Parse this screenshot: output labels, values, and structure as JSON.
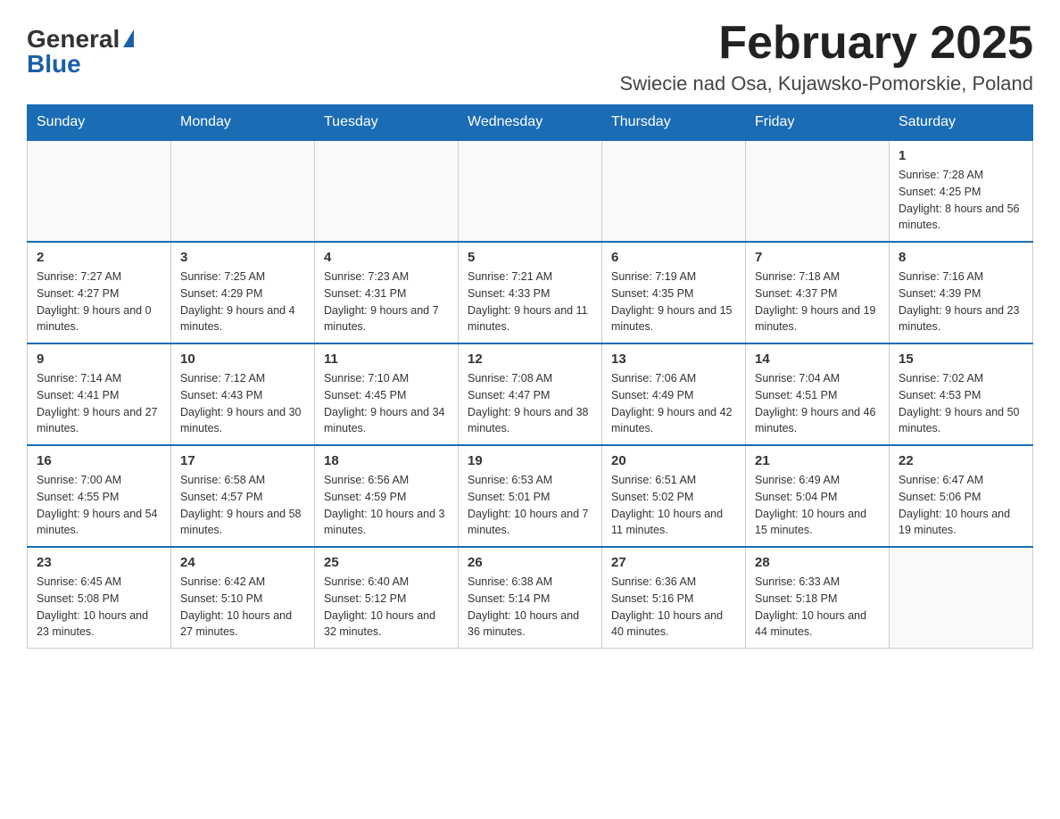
{
  "header": {
    "logo_general": "General",
    "logo_blue": "Blue",
    "title": "February 2025",
    "subtitle": "Swiecie nad Osa, Kujawsko-Pomorskie, Poland"
  },
  "days_of_week": [
    "Sunday",
    "Monday",
    "Tuesday",
    "Wednesday",
    "Thursday",
    "Friday",
    "Saturday"
  ],
  "weeks": [
    [
      {
        "day": "",
        "info": ""
      },
      {
        "day": "",
        "info": ""
      },
      {
        "day": "",
        "info": ""
      },
      {
        "day": "",
        "info": ""
      },
      {
        "day": "",
        "info": ""
      },
      {
        "day": "",
        "info": ""
      },
      {
        "day": "1",
        "info": "Sunrise: 7:28 AM\nSunset: 4:25 PM\nDaylight: 8 hours and 56 minutes."
      }
    ],
    [
      {
        "day": "2",
        "info": "Sunrise: 7:27 AM\nSunset: 4:27 PM\nDaylight: 9 hours and 0 minutes."
      },
      {
        "day": "3",
        "info": "Sunrise: 7:25 AM\nSunset: 4:29 PM\nDaylight: 9 hours and 4 minutes."
      },
      {
        "day": "4",
        "info": "Sunrise: 7:23 AM\nSunset: 4:31 PM\nDaylight: 9 hours and 7 minutes."
      },
      {
        "day": "5",
        "info": "Sunrise: 7:21 AM\nSunset: 4:33 PM\nDaylight: 9 hours and 11 minutes."
      },
      {
        "day": "6",
        "info": "Sunrise: 7:19 AM\nSunset: 4:35 PM\nDaylight: 9 hours and 15 minutes."
      },
      {
        "day": "7",
        "info": "Sunrise: 7:18 AM\nSunset: 4:37 PM\nDaylight: 9 hours and 19 minutes."
      },
      {
        "day": "8",
        "info": "Sunrise: 7:16 AM\nSunset: 4:39 PM\nDaylight: 9 hours and 23 minutes."
      }
    ],
    [
      {
        "day": "9",
        "info": "Sunrise: 7:14 AM\nSunset: 4:41 PM\nDaylight: 9 hours and 27 minutes."
      },
      {
        "day": "10",
        "info": "Sunrise: 7:12 AM\nSunset: 4:43 PM\nDaylight: 9 hours and 30 minutes."
      },
      {
        "day": "11",
        "info": "Sunrise: 7:10 AM\nSunset: 4:45 PM\nDaylight: 9 hours and 34 minutes."
      },
      {
        "day": "12",
        "info": "Sunrise: 7:08 AM\nSunset: 4:47 PM\nDaylight: 9 hours and 38 minutes."
      },
      {
        "day": "13",
        "info": "Sunrise: 7:06 AM\nSunset: 4:49 PM\nDaylight: 9 hours and 42 minutes."
      },
      {
        "day": "14",
        "info": "Sunrise: 7:04 AM\nSunset: 4:51 PM\nDaylight: 9 hours and 46 minutes."
      },
      {
        "day": "15",
        "info": "Sunrise: 7:02 AM\nSunset: 4:53 PM\nDaylight: 9 hours and 50 minutes."
      }
    ],
    [
      {
        "day": "16",
        "info": "Sunrise: 7:00 AM\nSunset: 4:55 PM\nDaylight: 9 hours and 54 minutes."
      },
      {
        "day": "17",
        "info": "Sunrise: 6:58 AM\nSunset: 4:57 PM\nDaylight: 9 hours and 58 minutes."
      },
      {
        "day": "18",
        "info": "Sunrise: 6:56 AM\nSunset: 4:59 PM\nDaylight: 10 hours and 3 minutes."
      },
      {
        "day": "19",
        "info": "Sunrise: 6:53 AM\nSunset: 5:01 PM\nDaylight: 10 hours and 7 minutes."
      },
      {
        "day": "20",
        "info": "Sunrise: 6:51 AM\nSunset: 5:02 PM\nDaylight: 10 hours and 11 minutes."
      },
      {
        "day": "21",
        "info": "Sunrise: 6:49 AM\nSunset: 5:04 PM\nDaylight: 10 hours and 15 minutes."
      },
      {
        "day": "22",
        "info": "Sunrise: 6:47 AM\nSunset: 5:06 PM\nDaylight: 10 hours and 19 minutes."
      }
    ],
    [
      {
        "day": "23",
        "info": "Sunrise: 6:45 AM\nSunset: 5:08 PM\nDaylight: 10 hours and 23 minutes."
      },
      {
        "day": "24",
        "info": "Sunrise: 6:42 AM\nSunset: 5:10 PM\nDaylight: 10 hours and 27 minutes."
      },
      {
        "day": "25",
        "info": "Sunrise: 6:40 AM\nSunset: 5:12 PM\nDaylight: 10 hours and 32 minutes."
      },
      {
        "day": "26",
        "info": "Sunrise: 6:38 AM\nSunset: 5:14 PM\nDaylight: 10 hours and 36 minutes."
      },
      {
        "day": "27",
        "info": "Sunrise: 6:36 AM\nSunset: 5:16 PM\nDaylight: 10 hours and 40 minutes."
      },
      {
        "day": "28",
        "info": "Sunrise: 6:33 AM\nSunset: 5:18 PM\nDaylight: 10 hours and 44 minutes."
      },
      {
        "day": "",
        "info": ""
      }
    ]
  ]
}
